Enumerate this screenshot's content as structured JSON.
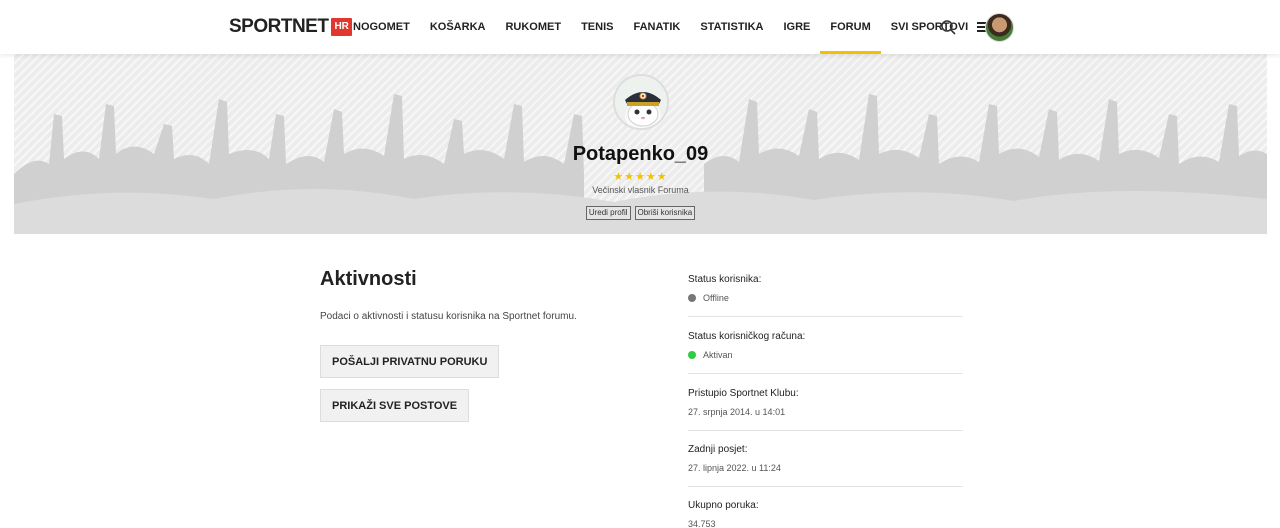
{
  "header": {
    "logo_text": "SPORTNET",
    "logo_badge": "HR",
    "nav": [
      {
        "label": "NOGOMET"
      },
      {
        "label": "KOŠARKA"
      },
      {
        "label": "RUKOMET"
      },
      {
        "label": "TENIS"
      },
      {
        "label": "FANATIK"
      },
      {
        "label": "STATISTIKA"
      },
      {
        "label": "IGRE"
      },
      {
        "label": "FORUM"
      },
      {
        "label": "SVI SPORTOVI"
      }
    ],
    "active_nav": "FORUM",
    "search_icon": "search-icon",
    "menu_icon": "hamburger-menu-icon"
  },
  "profile": {
    "username": "Potapenko_09",
    "stars": "★★★★★",
    "rank": "Večinski vlasnik Foruma",
    "edit_label": "Uredi profil",
    "delete_label": "Obriši korisnika"
  },
  "activity": {
    "title": "Aktivnosti",
    "description": "Podaci o aktivnosti i statusu korisnika na Sportnet forumu.",
    "send_message_label": "POŠALJI PRIVATNU PORUKU",
    "show_posts_label": "PRIKAŽI SVE POSTOVE"
  },
  "status": [
    {
      "label": "Status korisnika:",
      "value": "Offline",
      "dot_color": "#777777"
    },
    {
      "label": "Status korisničkog računa:",
      "value": "Aktivan",
      "dot_color": "#2ecc40"
    },
    {
      "label": "Pristupio Sportnet Klubu:",
      "value": "27. srpnja 2014. u 14:01"
    },
    {
      "label": "Zadnji posjet:",
      "value": "27. lipnja 2022. u 11:24"
    },
    {
      "label": "Ukupno poruka:",
      "value": "34.753"
    }
  ],
  "colors": {
    "accent": "#f2c200",
    "brand_badge": "#e0382e",
    "online_green": "#2ecc40"
  }
}
